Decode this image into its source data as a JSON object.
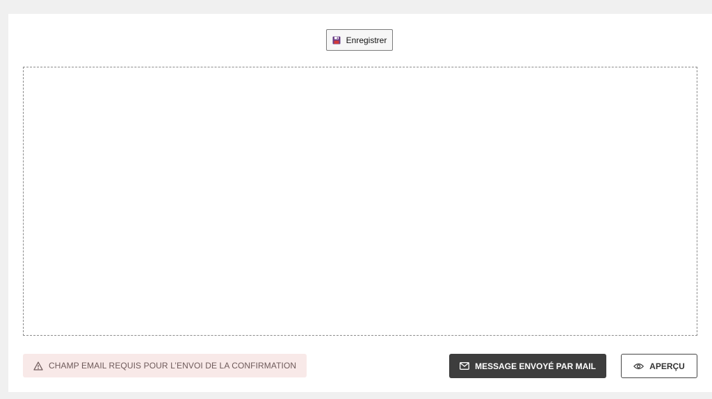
{
  "toolbar": {
    "save_label": "Enregistrer",
    "save_icon": "floppy-disk-icon"
  },
  "warning": {
    "text": "CHAMP EMAIL REQUIS POUR L’ENVOI DE LA CONFIRMATION",
    "icon": "warning-triangle-icon"
  },
  "actions": {
    "mail_label": "MESSAGE ENVOYÉ PAR MAIL",
    "mail_icon": "envelope-icon",
    "preview_label": "APERÇU",
    "preview_icon": "eye-icon"
  },
  "colors": {
    "background": "#f0f0f0",
    "panel": "#ffffff",
    "warning_bg": "#f8e9e8",
    "warning_text": "#6e5a5a",
    "dark_button": "#3d3d3d",
    "floppy_purple": "#6a3d86",
    "floppy_red": "#d23a3a"
  }
}
